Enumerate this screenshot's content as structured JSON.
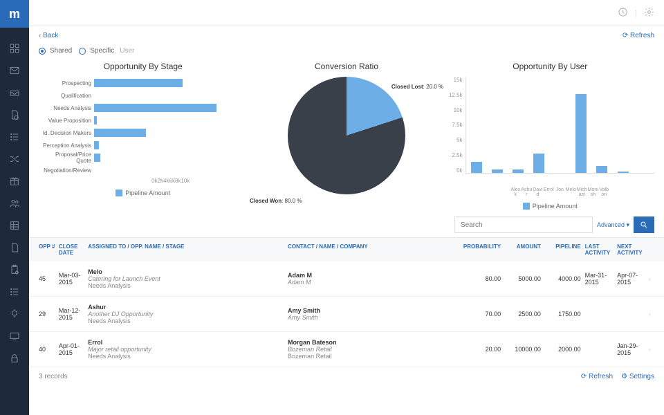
{
  "header": {
    "back": "Back",
    "refresh": "Refresh"
  },
  "filters": {
    "shared": "Shared",
    "specific": "Specific",
    "user": "User"
  },
  "chart_data": [
    {
      "type": "bar",
      "orientation": "horizontal",
      "title": "Opportunity By Stage",
      "categories": [
        "Prospecting",
        "Qualification",
        "Needs Analysis",
        "Value Proposition",
        "Id. Decision Makers",
        "Perception Analysis",
        "Proposal/Price Quote",
        "Negotiation/Review"
      ],
      "values": [
        5800,
        0,
        8000,
        200,
        3400,
        300,
        400,
        0
      ],
      "xlabel": "",
      "xlim": [
        0,
        10000
      ],
      "xticks": [
        "0k",
        "2k",
        "4k",
        "6k",
        "8k",
        "10k"
      ],
      "legend": "Pipeline Amount"
    },
    {
      "type": "pie",
      "title": "Conversion Ratio",
      "series": [
        {
          "name": "Closed Lost",
          "value": 20.0,
          "label": "20.0 %"
        },
        {
          "name": "Closed Won",
          "value": 80.0,
          "label": "80.0 %"
        }
      ]
    },
    {
      "type": "bar",
      "orientation": "vertical",
      "title": "Opportunity By User",
      "categories": [
        "Alex k",
        "Ashur",
        "David",
        "Errol",
        "Jon",
        "Melo",
        "Michael",
        "Monish",
        "Valbon"
      ],
      "values": [
        1750,
        500,
        500,
        3000,
        0,
        12200,
        1100,
        250,
        0
      ],
      "ylim": [
        0,
        15000
      ],
      "yticks": [
        "15k",
        "12.5k",
        "10k",
        "7.5k",
        "5k",
        "2.5k",
        "0k"
      ],
      "legend": "Pipeline Amount"
    }
  ],
  "search": {
    "placeholder": "Search",
    "advanced": "Advanced"
  },
  "table": {
    "headers": {
      "opp": "OPP #",
      "close": "CLOSE DATE",
      "assigned": "ASSIGNED TO / OPP. NAME / STAGE",
      "contact": "CONTACT / NAME / COMPANY",
      "prob": "PROBABILITY",
      "amount": "AMOUNT",
      "pipe": "PIPELINE",
      "last": "LAST ACTIVITY",
      "next": "NEXT ACTIVITY"
    },
    "rows": [
      {
        "opp": "45",
        "date": "Mar-03-2015",
        "assigned": "Melo",
        "oppname": "Catering for Launch Event",
        "stage": "Needs Analysis",
        "contact": "Adam M",
        "cname": "Adam M",
        "company": "",
        "prob": "80.00",
        "amount": "5000.00",
        "pipe": "4000.00",
        "last": "Mar-31-2015",
        "next": "Apr-07-2015"
      },
      {
        "opp": "29",
        "date": "Mar-12-2015",
        "assigned": "Ashur",
        "oppname": "Another DJ Opportunity",
        "stage": "Needs Analysis",
        "contact": "Amy Smith",
        "cname": "Amy Smith",
        "company": "",
        "prob": "70.00",
        "amount": "2500.00",
        "pipe": "1750.00",
        "last": "",
        "next": ""
      },
      {
        "opp": "40",
        "date": "Apr-01-2015",
        "assigned": "Errol",
        "oppname": "Major retail opportunity",
        "stage": "Needs Analysis",
        "contact": "Morgan Bateson",
        "cname": "Bozeman Retail",
        "company": "Bozeman Retail",
        "prob": "20.00",
        "amount": "10000.00",
        "pipe": "2000.00",
        "last": "",
        "next": "Jan-29-2015"
      }
    ]
  },
  "footer": {
    "records": "3 records",
    "refresh": "Refresh",
    "settings": "Settings"
  }
}
